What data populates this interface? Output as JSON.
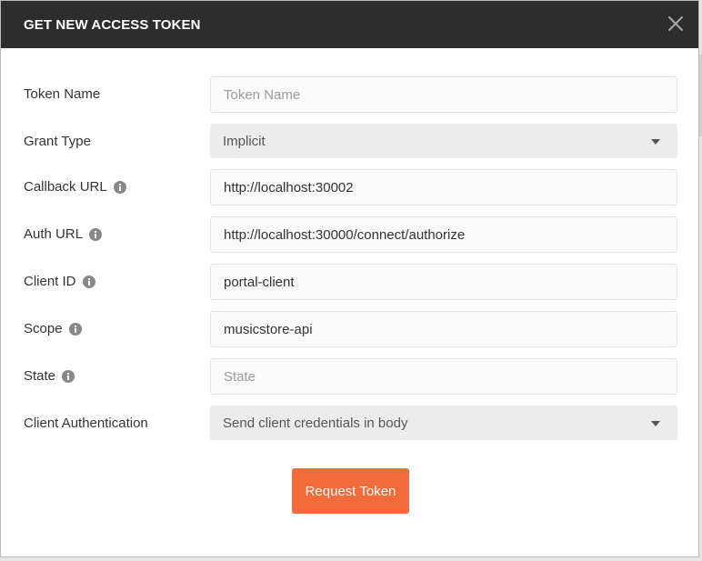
{
  "dialog": {
    "title": "GET NEW ACCESS TOKEN",
    "close_icon": "close-icon"
  },
  "form": {
    "token_name": {
      "label": "Token Name",
      "value": "",
      "placeholder": "Token Name"
    },
    "grant_type": {
      "label": "Grant Type",
      "value": "Implicit"
    },
    "callback_url": {
      "label": "Callback URL",
      "value": "http://localhost:30002",
      "placeholder": ""
    },
    "auth_url": {
      "label": "Auth URL",
      "value": "http://localhost:30000/connect/authorize",
      "placeholder": ""
    },
    "client_id": {
      "label": "Client ID",
      "value": "portal-client",
      "placeholder": ""
    },
    "scope": {
      "label": "Scope",
      "value": "musicstore-api",
      "placeholder": ""
    },
    "state": {
      "label": "State",
      "value": "",
      "placeholder": "State"
    },
    "client_authentication": {
      "label": "Client Authentication",
      "value": "Send client credentials in body"
    }
  },
  "actions": {
    "request_token_label": "Request Token"
  },
  "colors": {
    "header_bg": "#2d2d2d",
    "accent": "#f26b3a",
    "info_icon": "#888888"
  }
}
